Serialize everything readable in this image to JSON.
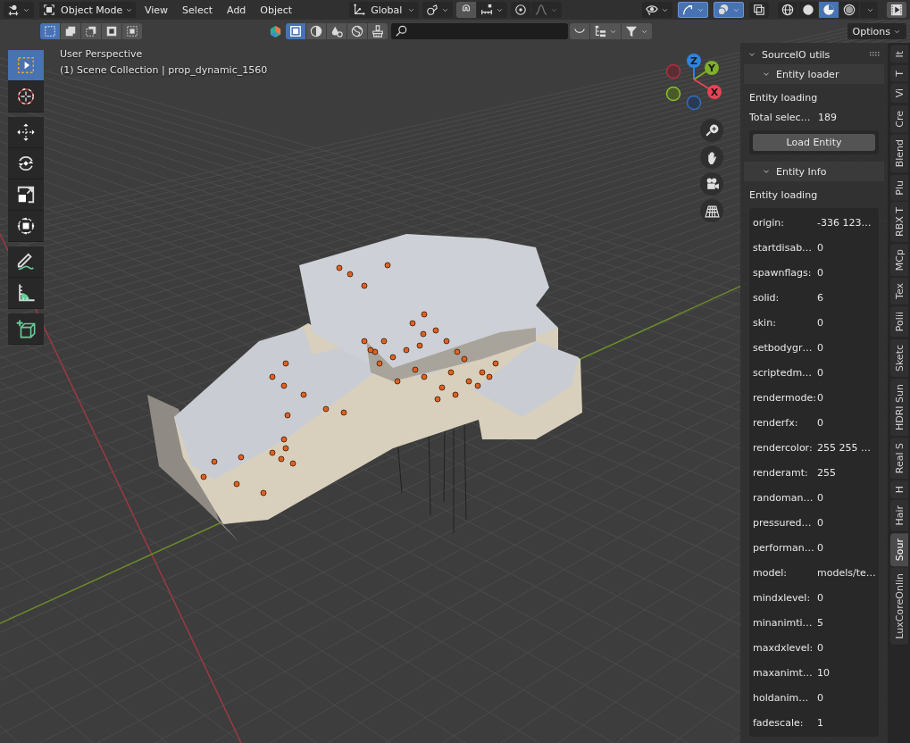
{
  "header": {
    "mode": "Object Mode",
    "menus": [
      "View",
      "Select",
      "Add",
      "Object"
    ],
    "orientation": "Global",
    "viewport_toggles": [
      {
        "kind": "visibility",
        "on": false
      },
      {
        "kind": "gizmos",
        "on": true
      },
      {
        "kind": "overlays",
        "on": true
      },
      {
        "kind": "xray",
        "on": false
      }
    ],
    "shading": [
      {
        "kind": "wireframe",
        "selected": false
      },
      {
        "kind": "solid",
        "selected": false
      },
      {
        "kind": "material",
        "selected": true
      },
      {
        "kind": "rendered",
        "selected": false
      }
    ]
  },
  "tool_header": {
    "select_modes": [
      {
        "kind": "set",
        "selected": true
      },
      {
        "kind": "extend",
        "selected": false
      },
      {
        "kind": "subtract",
        "selected": false
      },
      {
        "kind": "invert",
        "selected": false
      },
      {
        "kind": "intersect",
        "selected": false
      }
    ],
    "object_filters": [
      {
        "kind": "object",
        "selected": true
      },
      {
        "kind": "half",
        "selected": false
      },
      {
        "kind": "drop",
        "selected": false
      },
      {
        "kind": "globe",
        "selected": false
      },
      {
        "kind": "brush",
        "selected": false
      }
    ],
    "options": "Options"
  },
  "viewport_info": [
    "User Perspective",
    "(1) Scene Collection | prop_dynamic_1560"
  ],
  "toolbar": [
    {
      "kind": "select",
      "selected": true
    },
    {
      "kind": "cursor",
      "selected": false
    },
    {
      "kind": "move",
      "selected": false
    },
    {
      "kind": "rotate",
      "selected": false
    },
    {
      "kind": "scale",
      "selected": false
    },
    {
      "kind": "transform",
      "selected": false
    },
    {
      "kind": "annotate",
      "selected": false
    },
    {
      "kind": "measure",
      "selected": false
    },
    {
      "kind": "add_cube",
      "selected": false
    }
  ],
  "gizmo": {
    "axes": [
      "Z",
      "Y",
      "X"
    ]
  },
  "sidebar": {
    "title": "SourceIO utils",
    "expanded": true,
    "entity_loader": {
      "title": "Entity loader",
      "expanded": true,
      "label": "Entity loading",
      "total_label": "Total selec…",
      "total_value": "189",
      "button": "Load Entity"
    },
    "entity_info": {
      "title": "Entity Info",
      "expanded": true,
      "label": "Entity loading",
      "properties": [
        {
          "key": "origin:",
          "value": "-336 123…"
        },
        {
          "key": "startdisab…",
          "value": "0"
        },
        {
          "key": "spawnflags:",
          "value": "0"
        },
        {
          "key": "solid:",
          "value": "6"
        },
        {
          "key": "skin:",
          "value": "0"
        },
        {
          "key": "setbodygr…",
          "value": "0"
        },
        {
          "key": "scriptedm…",
          "value": "0"
        },
        {
          "key": "rendermode:",
          "value": "0"
        },
        {
          "key": "renderfx:",
          "value": "0"
        },
        {
          "key": "rendercolor:",
          "value": "255 255 …"
        },
        {
          "key": "renderamt:",
          "value": "255"
        },
        {
          "key": "randoman…",
          "value": "0"
        },
        {
          "key": "pressured…",
          "value": "0"
        },
        {
          "key": "performan…",
          "value": "0"
        },
        {
          "key": "model:",
          "value": "models/te…"
        },
        {
          "key": "mindxlevel:",
          "value": "0"
        },
        {
          "key": "minanimti…",
          "value": "5"
        },
        {
          "key": "maxdxlevel:",
          "value": "0"
        },
        {
          "key": "maxanimt…",
          "value": "10"
        },
        {
          "key": "holdanim…",
          "value": "0"
        },
        {
          "key": "fadescale:",
          "value": "1"
        }
      ]
    }
  },
  "tabs": [
    {
      "label": "It",
      "selected": false
    },
    {
      "label": "T",
      "selected": false
    },
    {
      "label": "Vi",
      "selected": false
    },
    {
      "label": "Cre",
      "selected": false
    },
    {
      "label": "Blend",
      "selected": false
    },
    {
      "label": "Plu",
      "selected": false
    },
    {
      "label": "RBX T",
      "selected": false
    },
    {
      "label": "MCp",
      "selected": false
    },
    {
      "label": "Tex",
      "selected": false
    },
    {
      "label": "Polii",
      "selected": false
    },
    {
      "label": "Sketc",
      "selected": false
    },
    {
      "label": "HDRI Sun",
      "selected": false
    },
    {
      "label": "Real S",
      "selected": false
    },
    {
      "label": "H",
      "selected": false
    },
    {
      "label": "Hair",
      "selected": false
    },
    {
      "label": "Sour",
      "selected": true
    },
    {
      "label": "LuxCoreOnlin",
      "selected": false
    }
  ]
}
